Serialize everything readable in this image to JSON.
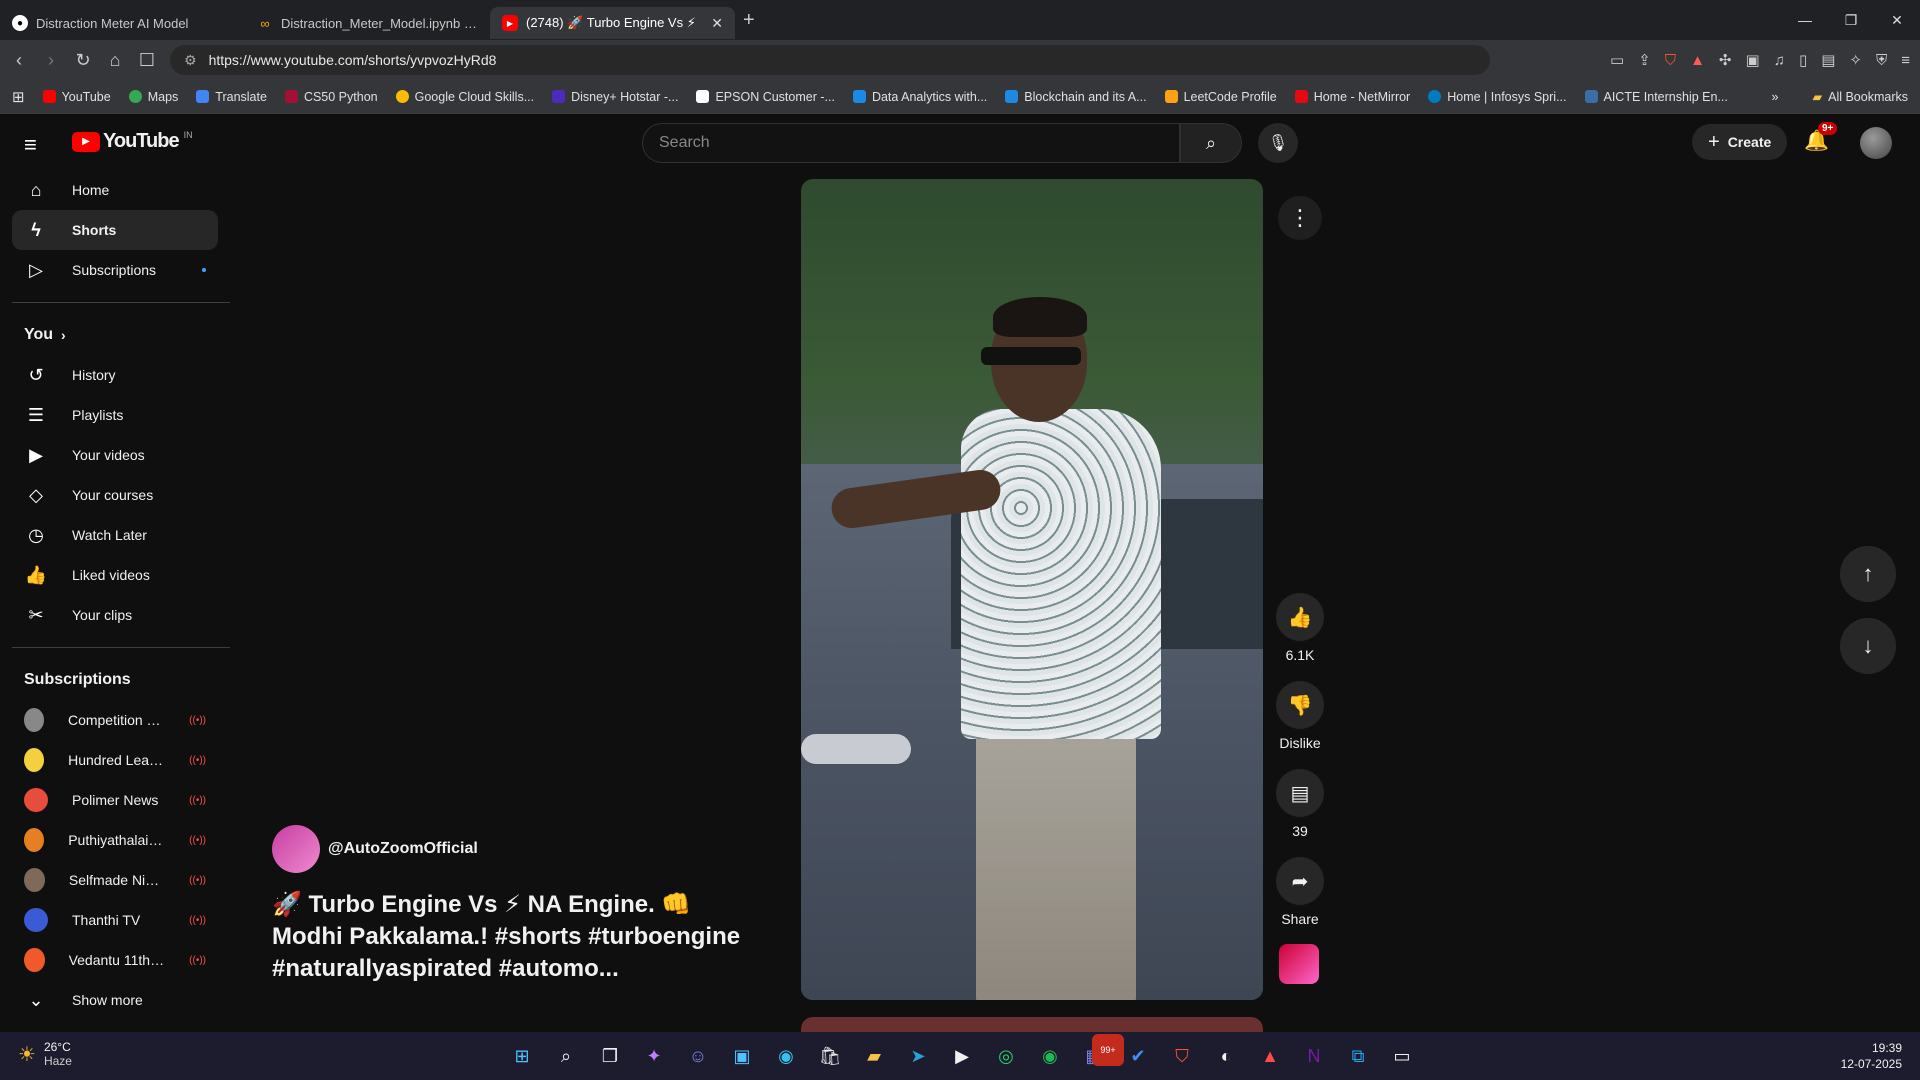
{
  "browser": {
    "tabs": [
      {
        "title": "Distraction Meter AI Model",
        "icon": "github-icon",
        "active": false
      },
      {
        "title": "Distraction_Meter_Model.ipynb - Col",
        "icon": "colab-icon",
        "active": false
      },
      {
        "title": "(2748) 🚀 Turbo Engine Vs ⚡",
        "icon": "youtube-icon",
        "active": true
      }
    ],
    "url": "https://www.youtube.com/shorts/yvpvozHyRd8",
    "bookmarks": [
      "YouTube",
      "Maps",
      "Translate",
      "CS50 Python",
      "Google Cloud Skills...",
      "Disney+ Hotstar -...",
      "EPSON Customer -...",
      "Data Analytics with...",
      "Blockchain and its A...",
      "LeetCode Profile",
      "Home - NetMirror",
      "Home | Infosys Spri...",
      "AICTE Internship En..."
    ],
    "all_bookmarks": "All Bookmarks"
  },
  "header": {
    "logo_text": "YouTube",
    "region": "IN",
    "search_placeholder": "Search",
    "create_label": "Create",
    "notifications_badge": "9+"
  },
  "sidebar": {
    "main": [
      {
        "label": "Home",
        "icon": "home-icon"
      },
      {
        "label": "Shorts",
        "icon": "shorts-icon",
        "active": true
      },
      {
        "label": "Subscriptions",
        "icon": "subscriptions-icon"
      }
    ],
    "you_heading": "You",
    "you_items": [
      {
        "label": "History",
        "icon": "history-icon"
      },
      {
        "label": "Playlists",
        "icon": "playlists-icon"
      },
      {
        "label": "Your videos",
        "icon": "your-videos-icon"
      },
      {
        "label": "Your courses",
        "icon": "courses-icon"
      },
      {
        "label": "Watch Later",
        "icon": "clock-icon"
      },
      {
        "label": "Liked videos",
        "icon": "thumbs-up-icon"
      },
      {
        "label": "Your clips",
        "icon": "scissors-icon"
      }
    ],
    "subs_heading": "Subscriptions",
    "subscriptions": [
      {
        "label": "Competition Wall...",
        "color": "#888888"
      },
      {
        "label": "Hundred Learnin...",
        "color": "#f4d03f"
      },
      {
        "label": "Polimer News",
        "color": "#e74c3c"
      },
      {
        "label": "Puthiyathalaimur...",
        "color": "#e67e22"
      },
      {
        "label": "Selfmade Ninja ...",
        "color": "#7f6a5a"
      },
      {
        "label": "Thanthi TV",
        "color": "#3b5bd6"
      },
      {
        "label": "Vedantu 11th 12...",
        "color": "#f05a28"
      }
    ],
    "show_more": "Show more"
  },
  "short": {
    "channel": "@AutoZoomOfficial",
    "title": "🚀 Turbo Engine Vs ⚡ NA Engine. 👊 Modhi Pakkalama.! #shorts #turboengine #naturallyaspirated #automo...",
    "likes": "6.1K",
    "dislike_label": "Dislike",
    "comments": "39",
    "share_label": "Share"
  },
  "taskbar": {
    "temperature": "26°C",
    "weather": "Haze",
    "time": "19:39",
    "date": "12-07-2025",
    "teams_badge": "99+"
  }
}
